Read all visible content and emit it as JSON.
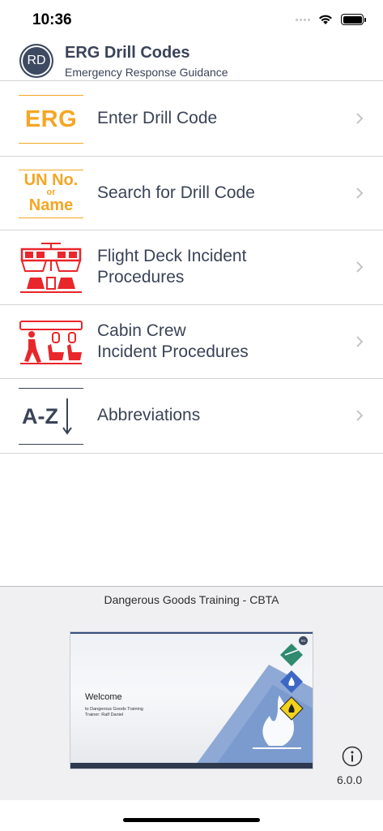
{
  "status_bar": {
    "time": "10:36"
  },
  "header": {
    "logo_text": "RD",
    "title": "ERG Drill Codes",
    "subtitle": "Emergency Response Guidance"
  },
  "menu": {
    "items": [
      {
        "label": "Enter Drill Code",
        "icon": "erg-icon",
        "icon_text": "ERG"
      },
      {
        "label": "Search for Drill Code",
        "icon": "un-number-or-name-icon",
        "icon_text_1": "UN No.",
        "icon_text_2": "or",
        "icon_text_3": "Name"
      },
      {
        "label": "Flight Deck Incident\nProcedures",
        "icon": "flight-deck-icon"
      },
      {
        "label": "Cabin Crew\nIncident Procedures",
        "icon": "cabin-crew-icon"
      },
      {
        "label": "Abbreviations",
        "icon": "a-z-icon",
        "icon_text": "A-Z"
      }
    ]
  },
  "promo": {
    "title": "Dangerous Goods Training - CBTA",
    "banner_welcome": "Welcome",
    "banner_line1": "to Dangerous Goods Training",
    "banner_line2": "Trainer: Ralf Daniel",
    "banner_badge": "RD"
  },
  "footer": {
    "version": "6.0.0"
  },
  "colors": {
    "accent_orange": "#f5a623",
    "accent_red": "#e8262b",
    "navy": "#3a4357"
  }
}
